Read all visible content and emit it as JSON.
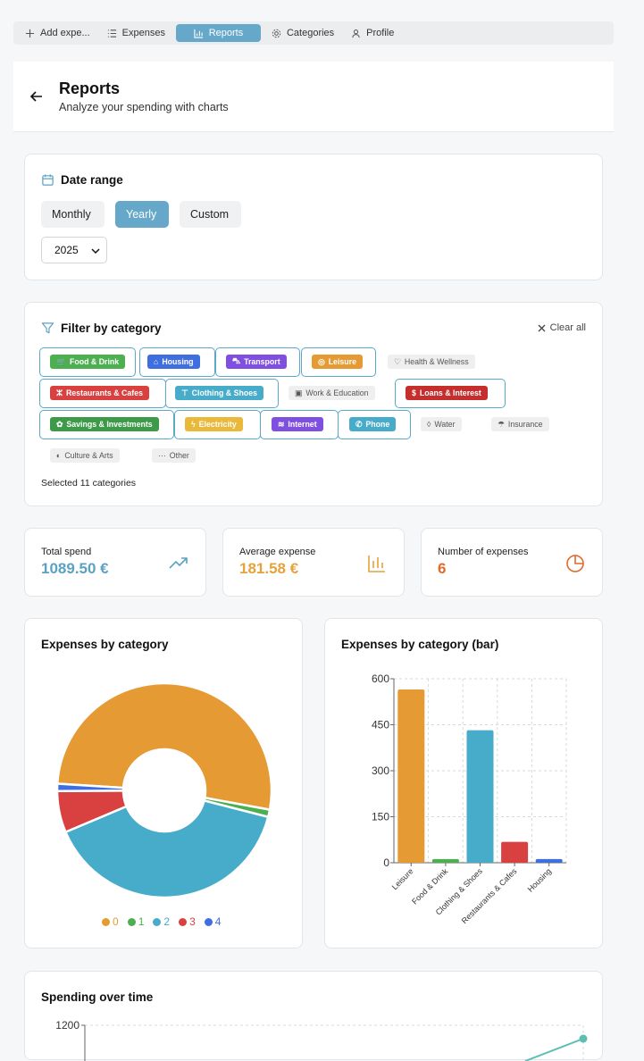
{
  "nav": {
    "tabs": [
      {
        "label": "Add expe..."
      },
      {
        "label": "Expenses"
      },
      {
        "label": "Reports"
      },
      {
        "label": "Categories"
      },
      {
        "label": "Profile"
      }
    ],
    "active": "Reports"
  },
  "header": {
    "title": "Reports",
    "subtitle": "Analyze your spending with charts"
  },
  "date_range": {
    "title": "Date range",
    "modes": [
      "Monthly",
      "Yearly",
      "Custom"
    ],
    "active_mode": "Yearly",
    "year": "2025"
  },
  "filter": {
    "title": "Filter by category",
    "clear_label": "Clear all",
    "selected_text": "Selected 11 categories",
    "categories": [
      {
        "label": "Food & Drink",
        "color": "#4caf50",
        "selected": true
      },
      {
        "label": "Housing",
        "color": "#3f6ee0",
        "selected": true
      },
      {
        "label": "Transport",
        "color": "#7e4fe0",
        "selected": true
      },
      {
        "label": "Leisure",
        "color": "#e69a34",
        "selected": true
      },
      {
        "label": "Health & Wellness",
        "selected": false
      },
      {
        "label": "Restaurants & Cafes",
        "color": "#d94141",
        "selected": true
      },
      {
        "label": "Clothing & Shoes",
        "color": "#47acc9",
        "selected": true
      },
      {
        "label": "Work & Education",
        "selected": false
      },
      {
        "label": "Loans & Interest",
        "color": "#c62e2e",
        "selected": true
      },
      {
        "label": "Savings & Investments",
        "color": "#3c9a48",
        "selected": true
      },
      {
        "label": "Electricity",
        "color": "#eab93a",
        "selected": true
      },
      {
        "label": "Internet",
        "color": "#7e4fe0",
        "selected": true
      },
      {
        "label": "Phone",
        "color": "#47acc9",
        "selected": true
      },
      {
        "label": "Water",
        "selected": false
      },
      {
        "label": "Insurance",
        "selected": false
      },
      {
        "label": "Culture & Arts",
        "selected": false
      },
      {
        "label": "Other",
        "selected": false
      }
    ]
  },
  "stats": {
    "total": {
      "label": "Total spend",
      "value": "1089.50 €",
      "color": "#5ba2c2"
    },
    "average": {
      "label": "Average expense",
      "value": "181.58 €",
      "color": "#e6a23c"
    },
    "count": {
      "label": "Number of expenses",
      "value": "6",
      "color": "#e06a2b"
    }
  },
  "charts": {
    "pie_title": "Expenses by category",
    "bar_title": "Expenses by category (bar)",
    "line_title": "Spending over time"
  },
  "chart_data": [
    {
      "type": "pie",
      "title": "Expenses by category",
      "labels": [
        "0",
        "1",
        "2",
        "3",
        "4"
      ],
      "values": [
        565,
        12,
        432,
        68,
        12
      ],
      "colors": [
        "#e69a34",
        "#4caf50",
        "#47acc9",
        "#d94141",
        "#3f6ee0"
      ]
    },
    {
      "type": "bar",
      "title": "Expenses by category (bar)",
      "categories": [
        "Leisure",
        "Food & Drink",
        "Clothing & Shoes",
        "Restaurants & Cafes",
        "Housing"
      ],
      "values": [
        565,
        12,
        432,
        68,
        12
      ],
      "colors": [
        "#e69a34",
        "#4caf50",
        "#47acc9",
        "#d94141",
        "#3f6ee0"
      ],
      "ylim": [
        0,
        600
      ],
      "yticks": [
        0,
        150,
        300,
        450,
        600
      ],
      "grid": true
    },
    {
      "type": "line",
      "title": "Spending over time",
      "yticks_visible": [
        1200
      ],
      "series_color": "#5bbfb5"
    }
  ]
}
